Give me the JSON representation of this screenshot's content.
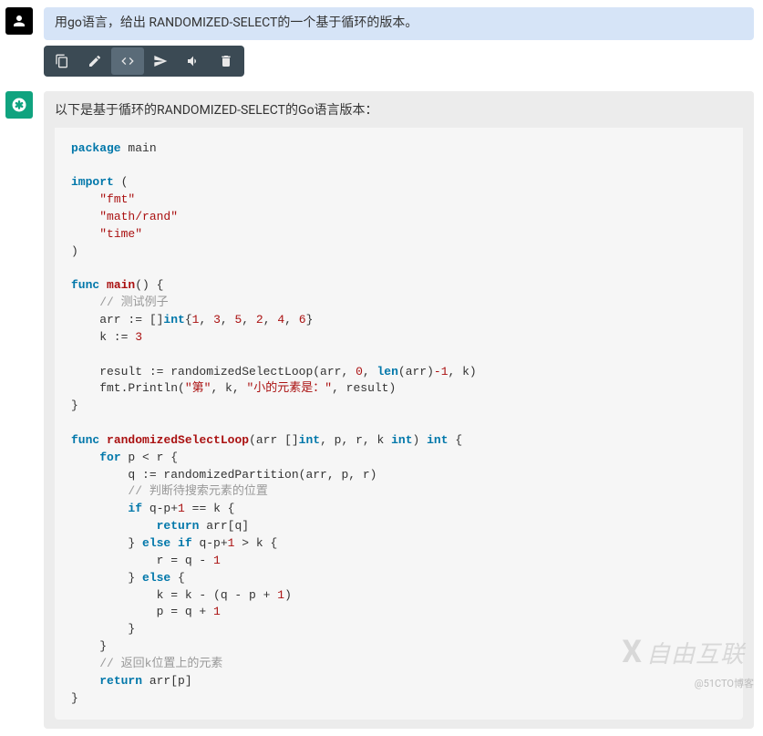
{
  "user": {
    "prompt": "用go语言，给出 RANDOMIZED-SELECT的一个基于循环的版本。"
  },
  "toolbar": {
    "items": [
      {
        "name": "copy-icon"
      },
      {
        "name": "edit-icon"
      },
      {
        "name": "code-icon"
      },
      {
        "name": "share-icon"
      },
      {
        "name": "volume-icon"
      },
      {
        "name": "delete-icon"
      }
    ]
  },
  "ai": {
    "intro": "以下是基于循环的RANDOMIZED-SELECT的Go语言版本：",
    "code": {
      "pkg_kw": "package",
      "pkg_name": " main",
      "import_kw": "import",
      "import_open": " (",
      "imp1": "\"fmt\"",
      "imp2": "\"math/rand\"",
      "imp3": "\"time\"",
      "import_close": ")",
      "func_kw": "func",
      "main_name": "main",
      "main_sig": "() {",
      "cmt_test": "// 测试例子",
      "arr_decl_a": "    arr := []",
      "int_kw": "int",
      "arr_vals_open": "{",
      "v1": "1",
      "v2": "3",
      "v3": "5",
      "v4": "2",
      "v5": "4",
      "v6": "6",
      "arr_vals_close": "}",
      "k_decl_a": "    k := ",
      "k_val": "3",
      "res_a": "    result := randomizedSelectLoop(arr, ",
      "zero": "0",
      "res_b": ", ",
      "len_kw": "len",
      "res_c": "(arr)",
      "minus1": "-1",
      "res_d": ", k)",
      "println_a": "    fmt.Println(",
      "str_di": "\"第\"",
      "println_b": ", k, ",
      "str_small": "\"小的元素是：\"",
      "println_c": ", result)",
      "close_brace": "}",
      "rsl_name": "randomizedSelectLoop",
      "rsl_sig_a": "(arr []",
      "rsl_sig_b": ", p, r, k ",
      "rsl_sig_c": ") ",
      "rsl_sig_d": " {",
      "for_kw": "for",
      "for_cond": " p < r {",
      "q_line": "        q := randomizedPartition(arr, p, r)",
      "cmt_judge": "// 判断待搜索元素的位置",
      "if_kw": "if",
      "if1_cond_a": " q-p+",
      "one": "1",
      "if1_cond_b": " == k {",
      "return_kw": "return",
      "ret1": " arr[q]",
      "else_kw": "else",
      "elseif_cond_a": " q-p+",
      "elseif_cond_b": " > k {",
      "r_assign_a": "            r = q - ",
      "else_open": " {",
      "k_assign_a": "            k = k - (q - p + ",
      "k_assign_b": ")",
      "p_assign_a": "            p = q + ",
      "inner_close": "        }",
      "for_close": "    }",
      "cmt_ret": "// 返回k位置上的元素",
      "ret2": " arr[p]"
    }
  },
  "watermark": {
    "small": "@51CTO博客",
    "logo_text": "自由互联"
  }
}
